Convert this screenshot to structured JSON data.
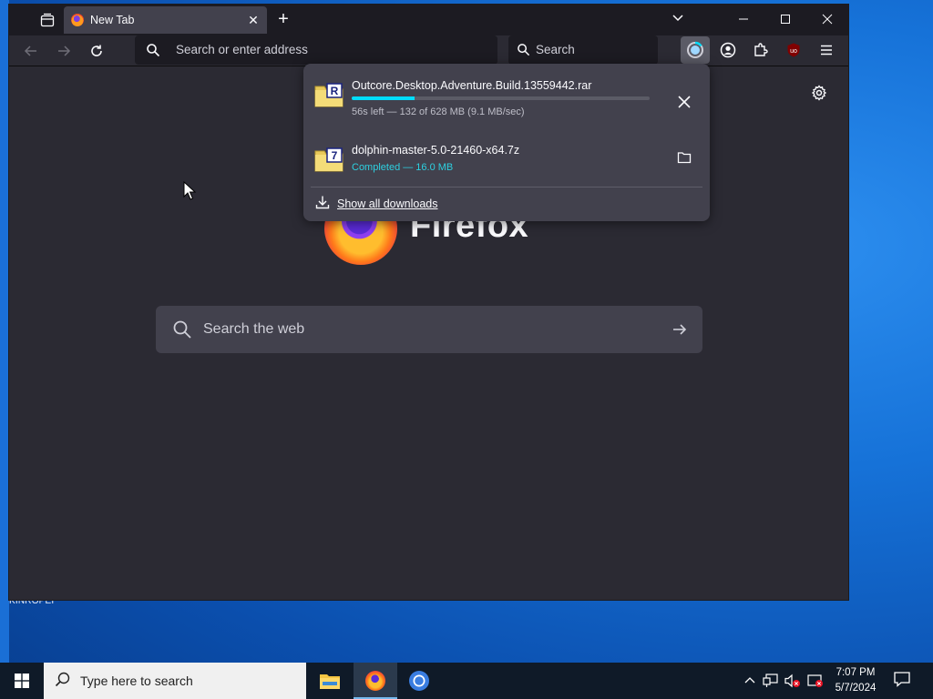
{
  "desktop": {
    "label": "KINROPEI"
  },
  "browser": {
    "tabs": [
      {
        "title": "New Tab"
      }
    ],
    "urlbar": {
      "placeholder": "Search or enter address"
    },
    "searchbar": {
      "placeholder": "Search"
    }
  },
  "newtab": {
    "wordmark": "Firefox",
    "search_placeholder": "Search the web"
  },
  "downloads": {
    "items": [
      {
        "name": "Outcore.Desktop.Adventure.Build.13559442.rar",
        "status": "56s left — 132 of 628 MB (9.1 MB/sec)",
        "progress": 0.21,
        "icon_letter": "R"
      },
      {
        "name": "dolphin-master-5.0-21460-x64.7z",
        "status": "Completed — 16.0 MB",
        "icon_letter": "7"
      }
    ],
    "show_all_label": "Show all downloads"
  },
  "taskbar": {
    "search_placeholder": "Type here to search",
    "clock": {
      "time": "7:07 PM",
      "date": "5/7/2024"
    }
  },
  "colors": {
    "accent": "#00ddff",
    "completed": "#2dd0e0",
    "toolbar": "#2b2a33",
    "tabstrip": "#1c1b22"
  }
}
